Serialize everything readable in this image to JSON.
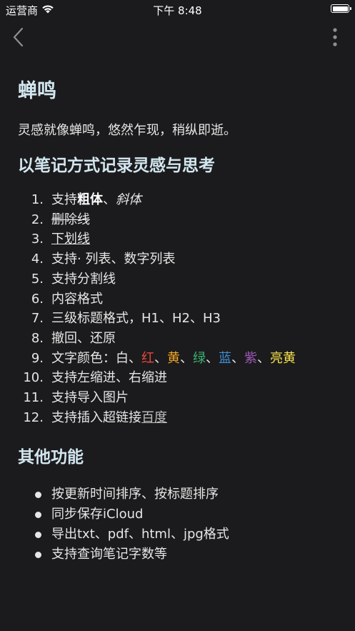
{
  "status_bar": {
    "carrier": "运营商",
    "time": "下午 8:48"
  },
  "note": {
    "title": "蝉鸣",
    "intro": "灵感就像蝉鸣，悠然乍现，稍纵即逝。",
    "section1": {
      "heading": "以笔记方式记录灵感与思考",
      "items": [
        {
          "num": "1.",
          "a": "支持",
          "b": "粗体",
          "c": "、",
          "d": "斜体"
        },
        {
          "num": "2.",
          "text": "删除线"
        },
        {
          "num": "3.",
          "text": "下划线"
        },
        {
          "num": "4.",
          "text": "支持· 列表、数字列表"
        },
        {
          "num": "5.",
          "text": "支持分割线"
        },
        {
          "num": "6.",
          "text": "内容格式"
        },
        {
          "num": "7.",
          "text": "三级标题格式，H1、H2、H3"
        },
        {
          "num": "8.",
          "text": "撤回、还原"
        },
        {
          "num": "9.",
          "prefix": "文字颜色：白、",
          "red": "红",
          "s1": "、",
          "yellow": "黄",
          "s2": "、",
          "green": "绿",
          "s3": "、",
          "blue": "蓝",
          "s4": "、",
          "purple": "紫",
          "s5": "、",
          "bright_yellow": "亮黄"
        },
        {
          "num": "10.",
          "text": "支持左缩进、右缩进"
        },
        {
          "num": "11.",
          "text": "支持导入图片"
        },
        {
          "num": "12.",
          "text": "支持插入超链接",
          "link": "百度"
        }
      ]
    },
    "section2": {
      "heading": "其他功能",
      "items": [
        "按更新时间排序、按标题排序",
        "同步保存iCloud",
        "导出txt、pdf、html、jpg格式",
        "支持查询笔记字数等"
      ]
    }
  },
  "colors": {
    "background": "#1b1b1d",
    "heading": "#d3e6ef",
    "text": "#e6e6e6",
    "red": "#e8483a",
    "yellow": "#f5a623",
    "green": "#3cb371",
    "blue": "#3f8fd2",
    "purple": "#9b59b6",
    "bright_yellow": "#f7e14a"
  },
  "icons": {
    "back": "chevron-left-icon",
    "more": "more-vertical-icon",
    "wifi": "wifi-icon",
    "battery": "battery-icon"
  }
}
